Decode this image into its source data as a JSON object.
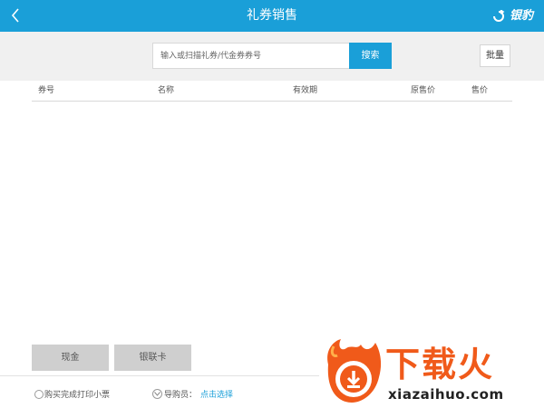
{
  "header": {
    "back_icon": "chevron-left-icon",
    "title": "礼券销售",
    "brand": "银豹",
    "brand_icon": "loop-arrow-icon",
    "background": "#1a9fd8"
  },
  "search": {
    "placeholder": "输入或扫描礼券/代金券券号",
    "value": "",
    "button_label": "搜索",
    "batch_label": "批量"
  },
  "table": {
    "columns": [
      "券号",
      "名称",
      "有效期",
      "原售价",
      "售价"
    ],
    "rows": []
  },
  "payment": {
    "cash_label": "现金",
    "unionpay_label": "银联卡"
  },
  "footer": {
    "print_receipt_label": "购买完成打印小票",
    "guide_label": "导购员：",
    "guide_link": "点击选择"
  },
  "watermark": {
    "text": "下载火",
    "url": "xiazaihuo.com",
    "accent": "#f05a1a"
  }
}
